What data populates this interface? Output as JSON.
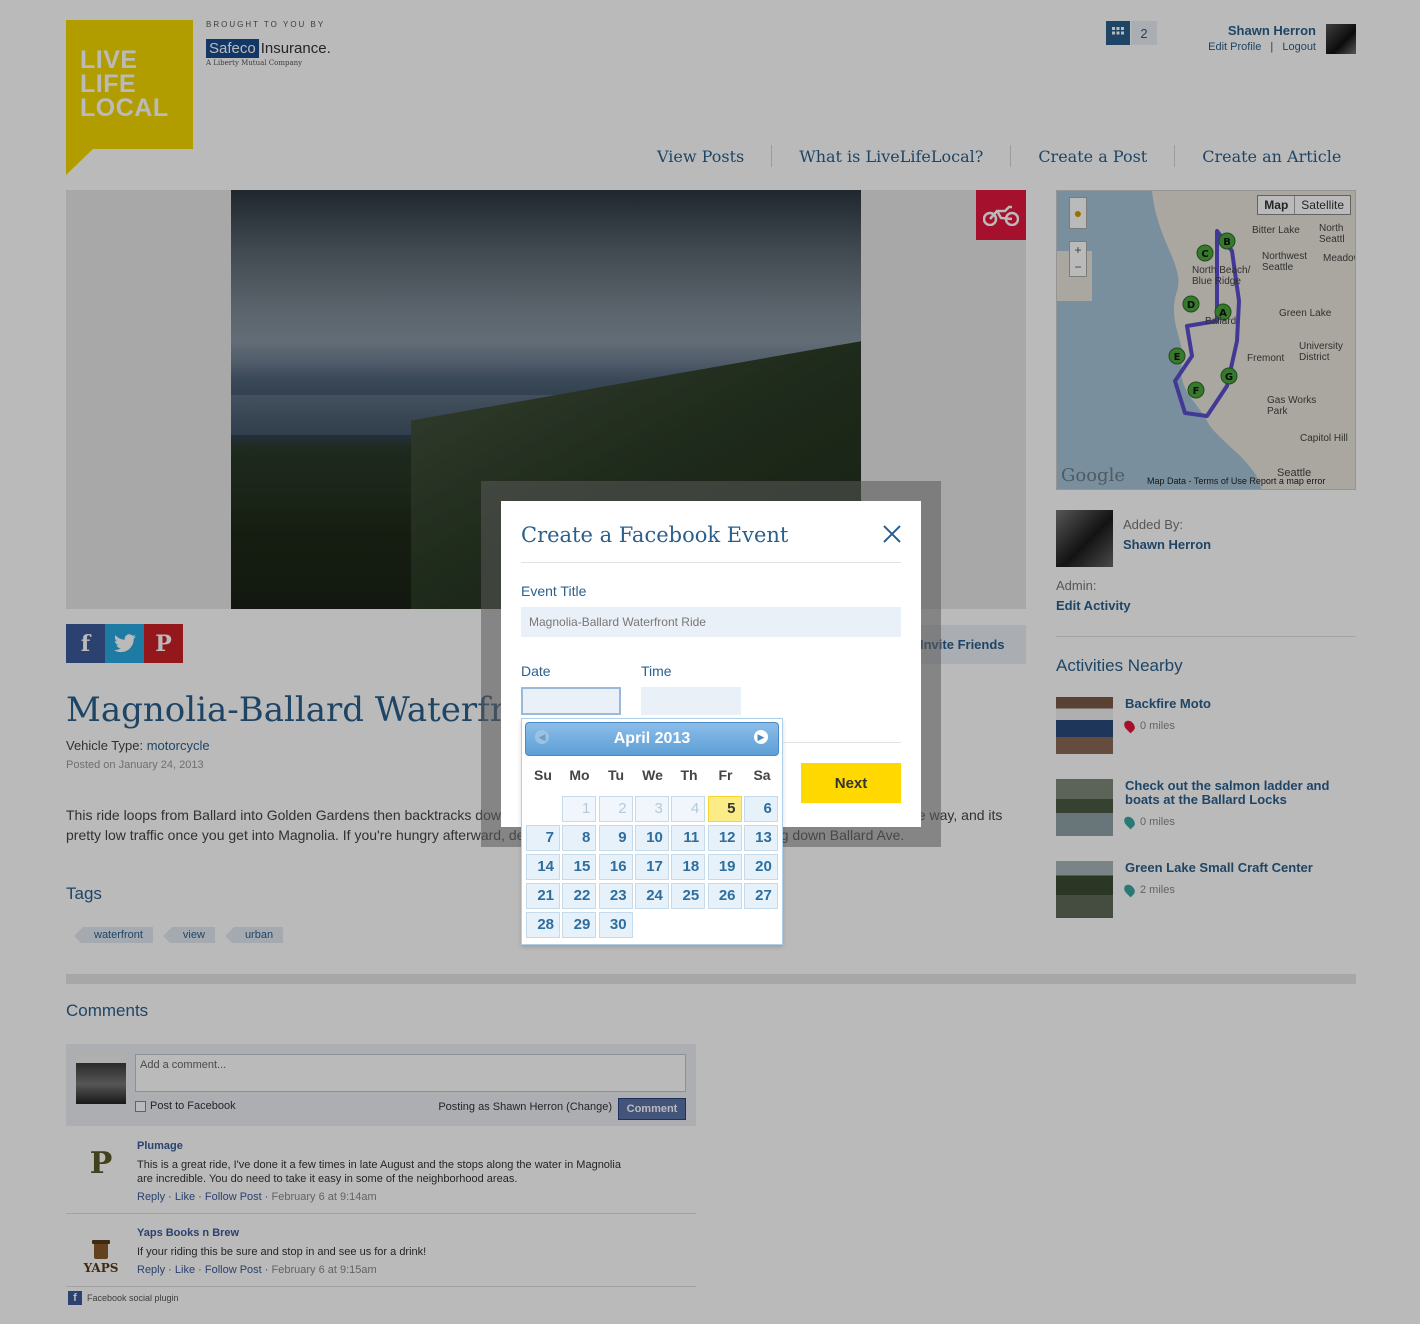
{
  "header": {
    "logo_lines": [
      "LIVE",
      "LIFE",
      "LOCAL"
    ],
    "brought_by": "BROUGHT TO YOU BY",
    "sponsor_box": "Safeco",
    "sponsor_rest": "Insurance.",
    "sponsor_tag": "A Liberty Mutual Company",
    "notification_count": "2",
    "user_name": "Shawn Herron",
    "edit_profile": "Edit Profile",
    "separator": "|",
    "logout": "Logout"
  },
  "nav": [
    "View Posts",
    "What is LiveLifeLocal?",
    "Create a Post",
    "Create an Article"
  ],
  "post": {
    "share_fb": "f",
    "share_tw": "t",
    "share_pin": "P",
    "invite_label": "Invite Friends",
    "title": "Magnolia-Ballard Waterfront Ride",
    "vehicle_label": "Vehicle Type:",
    "vehicle_value": "motorcycle",
    "posted": "Posted on January 24, 2013",
    "description": "This ride loops from Ballard into Golden Gardens then backtracks down the waterfront into Magnolia. There are lots of view stops along the way, and its pretty low traffic once you get into Magnolia. If you're hungry afterward, definitely checkout Hillard's Brewery or swing down Ballard Ave.",
    "tags_heading": "Tags",
    "tags": [
      "waterfront",
      "view",
      "urban"
    ]
  },
  "map": {
    "btn_map": "Map",
    "btn_satellite": "Satellite",
    "labels": [
      "Bitter Lake",
      "North Seattl",
      "Northwest Seattle",
      "Meadow",
      "North Beach/ Blue Ridge",
      "Green Lake",
      "Ballard",
      "Fremont",
      "University District",
      "Gas Works Park",
      "Capitol Hill",
      "Seattle"
    ],
    "markers": [
      "A",
      "B",
      "C",
      "D",
      "E",
      "F",
      "G"
    ],
    "google": "Google",
    "footer": "Map Data - Terms of Use  Report a map error"
  },
  "sidebar": {
    "added_by_label": "Added By:",
    "added_by_name": "Shawn Herron",
    "admin_label": "Admin:",
    "admin_link": "Edit Activity",
    "nearby_heading": "Activities Nearby",
    "nearby": [
      {
        "title": "Backfire Moto",
        "distance": "0 miles",
        "pin_color": "#e2173d"
      },
      {
        "title": "Check out the salmon ladder and boats at the Ballard Locks",
        "distance": "0 miles",
        "pin_color": "#3aa6a0"
      },
      {
        "title": "Green Lake Small Craft Center",
        "distance": "2 miles",
        "pin_color": "#3aa6a0"
      }
    ]
  },
  "comments": {
    "heading": "Comments",
    "placeholder": "Add a comment...",
    "post_to_facebook": "Post to Facebook",
    "posting_as": "Posting as Shawn Herron (Change)",
    "comment_btn": "Comment",
    "items": [
      {
        "name": "Plumage",
        "text": "This is a great ride, I've done it a few times in late August and the stops along the water in Magnolia are incredible. You do need to take it easy in some of the neighborhood areas.",
        "actions": "Reply · Like · Follow Post ·",
        "time": "February 6 at 9:14am"
      },
      {
        "name": "Yaps Books n Brew",
        "text": "If your riding this be sure and stop in and see us for a drink!",
        "actions": "Reply · Like · Follow Post ·",
        "time": "February 6 at 9:15am"
      }
    ],
    "plugin_label": "Facebook social plugin"
  },
  "modal": {
    "title": "Create a Facebook Event",
    "event_title_label": "Event Title",
    "event_title_placeholder": "Magnolia-Ballard Waterfront Ride",
    "date_label": "Date",
    "time_label": "Time",
    "next_label": "Next"
  },
  "datepicker": {
    "month": "April 2013",
    "days_of_week": [
      "Su",
      "Mo",
      "Tu",
      "We",
      "Th",
      "Fr",
      "Sa"
    ],
    "leading_other_month": [
      "1",
      "2",
      "3",
      "4"
    ],
    "today": "5",
    "days": [
      "6",
      "7",
      "8",
      "9",
      "10",
      "11",
      "12",
      "13",
      "14",
      "15",
      "16",
      "17",
      "18",
      "19",
      "20",
      "21",
      "22",
      "23",
      "24",
      "25",
      "26",
      "27",
      "28",
      "29",
      "30"
    ]
  },
  "colors": {
    "brand_blue": "#2b5f8c",
    "logo_yellow": "#f5d800",
    "next_yellow": "#ffd800",
    "badge_red": "#e2173d"
  }
}
